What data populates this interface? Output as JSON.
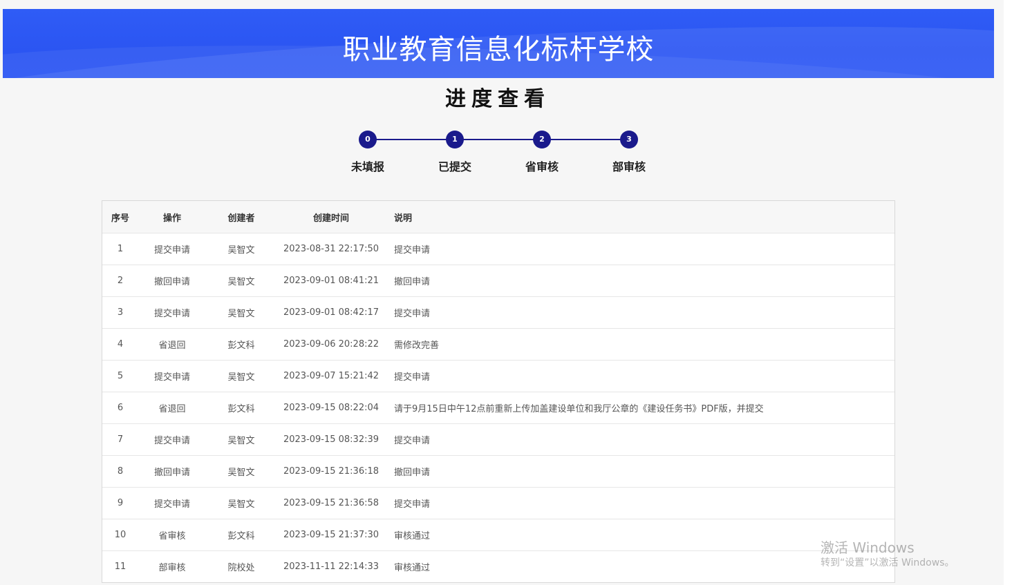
{
  "banner": {
    "title": "职业教育信息化标杆学校"
  },
  "page": {
    "title": "进度查看"
  },
  "steps": [
    {
      "index": "0",
      "label": "未填报"
    },
    {
      "index": "1",
      "label": "已提交"
    },
    {
      "index": "2",
      "label": "省审核"
    },
    {
      "index": "3",
      "label": "部审核"
    }
  ],
  "table": {
    "headers": [
      "序号",
      "操作",
      "创建者",
      "创建时间",
      "说明"
    ],
    "rows": [
      [
        "1",
        "提交申请",
        "吴智文",
        "2023-08-31 22:17:50",
        "提交申请"
      ],
      [
        "2",
        "撤回申请",
        "吴智文",
        "2023-09-01 08:41:21",
        "撤回申请"
      ],
      [
        "3",
        "提交申请",
        "吴智文",
        "2023-09-01 08:42:17",
        "提交申请"
      ],
      [
        "4",
        "省退回",
        "彭文科",
        "2023-09-06 20:28:22",
        "需修改完善"
      ],
      [
        "5",
        "提交申请",
        "吴智文",
        "2023-09-07 15:21:42",
        "提交申请"
      ],
      [
        "6",
        "省退回",
        "彭文科",
        "2023-09-15 08:22:04",
        "请于9月15日中午12点前重新上传加盖建设单位和我厅公章的《建设任务书》PDF版，并提交"
      ],
      [
        "7",
        "提交申请",
        "吴智文",
        "2023-09-15 08:32:39",
        "提交申请"
      ],
      [
        "8",
        "撤回申请",
        "吴智文",
        "2023-09-15 21:36:18",
        "撤回申请"
      ],
      [
        "9",
        "提交申请",
        "吴智文",
        "2023-09-15 21:36:58",
        "提交申请"
      ],
      [
        "10",
        "省审核",
        "彭文科",
        "2023-09-15 21:37:30",
        "审核通过"
      ],
      [
        "11",
        "部审核",
        "院校处",
        "2023-11-11 22:14:33",
        "审核通过"
      ]
    ]
  },
  "watermark": {
    "line1": "激活 Windows",
    "line2": "转到“设置”以激活 Windows。"
  }
}
